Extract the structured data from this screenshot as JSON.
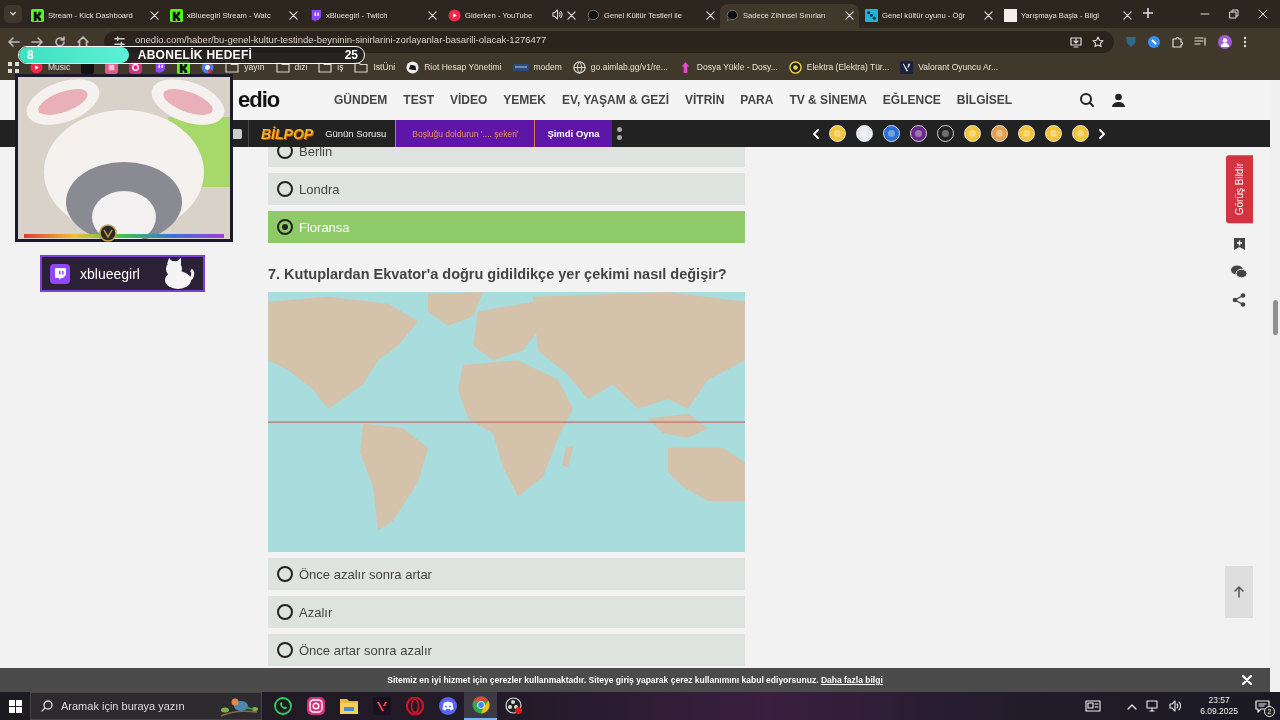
{
  "browser": {
    "tabs": [
      {
        "title": "Stream - Kick Dashboard",
        "kind": "kick",
        "selected": false,
        "audio": false
      },
      {
        "title": "xBlueegirl Stream - Watc",
        "kind": "kick",
        "selected": false,
        "audio": false
      },
      {
        "title": "xBlueegirl - Twitch",
        "kind": "twitch",
        "selected": false,
        "audio": false
      },
      {
        "title": "Giderken - YouTube",
        "kind": "youtube",
        "selected": false,
        "audio": true
      },
      {
        "title": "Genel Kültür Testleri ile",
        "kind": "chat",
        "selected": false,
        "audio": false
      },
      {
        "title": "Sadece Zihinsel Sınırları",
        "kind": "chat",
        "selected": true,
        "audio": false
      },
      {
        "title": "Genel kültür oyunu - Öğr",
        "kind": "puzzle",
        "selected": false,
        "audio": false
      },
      {
        "title": "Yarışmaya Başla - Bilgi",
        "kind": "blank",
        "selected": false,
        "audio": false
      }
    ],
    "address": "onedio.com/haber/bu-genel-kultur-testinde-beyninin-sinirlarini-zorlayanlar-basarili-olacak-1276477",
    "bookmarks": [
      {
        "label": "Music",
        "kind": "youtube"
      },
      {
        "kind": "dark"
      },
      {
        "kind": "pinterest"
      },
      {
        "kind": "instagram"
      },
      {
        "kind": "twitch"
      },
      {
        "kind": "kick"
      },
      {
        "kind": "chrome"
      },
      {
        "label": "yayın",
        "kind": "folder"
      },
      {
        "label": "dizi",
        "kind": "folder"
      },
      {
        "label": "iş",
        "kind": "folder"
      },
      {
        "label": "IstÜni",
        "kind": "folder"
      },
      {
        "label": "Riot Hesap Yönetimi",
        "kind": "riot"
      },
      {
        "label": "modem",
        "kind": "modem"
      },
      {
        "label": "go.aimlab.gg/v1/re...",
        "kind": "globe"
      },
      {
        "label": "Dosya Yükle - Dosy...",
        "kind": "upload"
      },
      {
        "label": "Elektra (Elektra) Tür...",
        "kind": "ring"
      },
      {
        "label": "Valorant Oyuncu Ar...",
        "kind": "valorant"
      }
    ]
  },
  "stream_overlay": {
    "goal": {
      "current": "8",
      "title": "ABONELİK HEDEFİ",
      "target": "25",
      "level": 0.32
    },
    "channel_name": "xblueegirl"
  },
  "site": {
    "logo": "edio",
    "nav": [
      "GÜNDEM",
      "TEST",
      "VİDEO",
      "YEMEK",
      "EV, YAŞAM & GEZİ",
      "VİTRİN",
      "PARA",
      "TV & SİNEMA",
      "EĞLENCE",
      "BİLGİSEL"
    ],
    "promo": {
      "brand": "BİLPOP",
      "label": "Günün Sorusu",
      "question": "Boşluğu doldurun '.... şekeri'",
      "action": "Şimdi Oyna"
    },
    "options_before": [
      {
        "label": "Berlin",
        "selected": false
      },
      {
        "label": "Londra",
        "selected": false
      },
      {
        "label": "Floransa",
        "selected": true
      }
    ],
    "question": "7. Kutuplardan Ekvator'a doğru gidildikçe yer çekimi nasıl değişir?",
    "options": [
      {
        "label": "Önce azalır sonra artar",
        "selected": false
      },
      {
        "label": "Azalır",
        "selected": false
      },
      {
        "label": "Önce artar sonra azalır",
        "selected": false
      }
    ],
    "feedback_button": "Görüş Bildir"
  },
  "cookie_bar": {
    "text": "Sitemiz en iyi hizmet için çerezler kullanmaktadır. Siteye giriş yaparak çerez kullanımını kabul ediyorsunuz.",
    "link": "Daha fazla bilgi"
  },
  "taskbar": {
    "search_placeholder": "Aramak için buraya yazın",
    "apps": [
      {
        "kind": "whatsapp",
        "active": false
      },
      {
        "kind": "instagram",
        "active": false
      },
      {
        "kind": "files",
        "active": false
      },
      {
        "kind": "valorant",
        "active": false
      },
      {
        "kind": "opera",
        "active": false
      },
      {
        "kind": "discord",
        "active": false
      },
      {
        "kind": "chrome",
        "active": true
      },
      {
        "kind": "obs",
        "active": false
      }
    ],
    "time": "23:57",
    "date": "6.09.2025",
    "notifications": "2"
  }
}
